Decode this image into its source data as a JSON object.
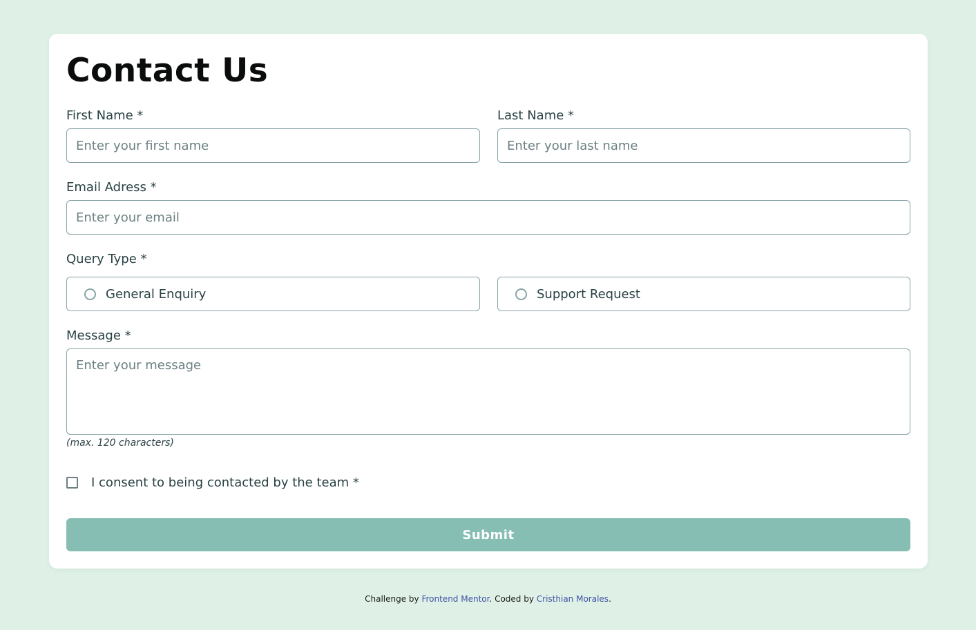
{
  "form": {
    "title": "Contact Us",
    "first_name": {
      "label": "First Name *",
      "placeholder": "Enter your first name",
      "value": ""
    },
    "last_name": {
      "label": "Last Name *",
      "placeholder": "Enter your last name",
      "value": ""
    },
    "email": {
      "label": "Email Adress *",
      "placeholder": "Enter your email",
      "value": ""
    },
    "query_type": {
      "label": "Query Type *",
      "options": [
        "General Enquiry",
        "Support Request"
      ],
      "selected": null
    },
    "message": {
      "label": "Message *",
      "placeholder": "Enter your message",
      "hint": "(max. 120 characters)",
      "value": ""
    },
    "consent": {
      "label": "I consent to being contacted by the team *",
      "checked": false
    },
    "submit_label": "Submit"
  },
  "footer": {
    "prefix": "Challenge by ",
    "link1": "Frontend Mentor",
    "middle": ". Coded by ",
    "link2": "Cristhian Morales",
    "suffix": "."
  },
  "colors": {
    "page_background": "#dff1e7",
    "card_background": "#ffffff",
    "field_border": "#87a3a6",
    "submit_background": "#86beb4",
    "link": "#3e52a3"
  }
}
